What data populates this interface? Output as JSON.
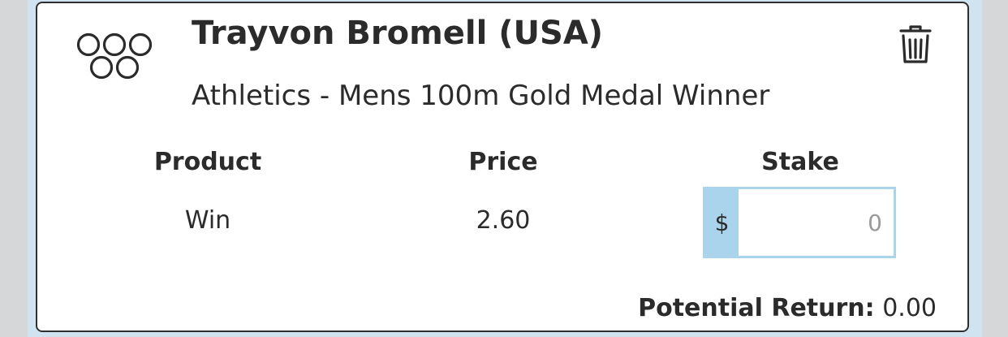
{
  "selection": {
    "title": "Trayvon Bromell (USA)",
    "subtitle": "Athletics - Mens 100m Gold Medal Winner",
    "icon": "olympic-rings-icon",
    "remove_icon": "trash-icon"
  },
  "columns": {
    "product_header": "Product",
    "price_header": "Price",
    "stake_header": "Stake"
  },
  "row": {
    "product": "Win",
    "price": "2.60",
    "stake_currency": "$",
    "stake_placeholder": "0",
    "stake_value": ""
  },
  "footer": {
    "potential_label": "Potential Return:",
    "potential_value": "0.00"
  },
  "colors": {
    "accent": "#a9d4ec",
    "border": "#2f2f2f",
    "background": "#d6d7d9"
  }
}
